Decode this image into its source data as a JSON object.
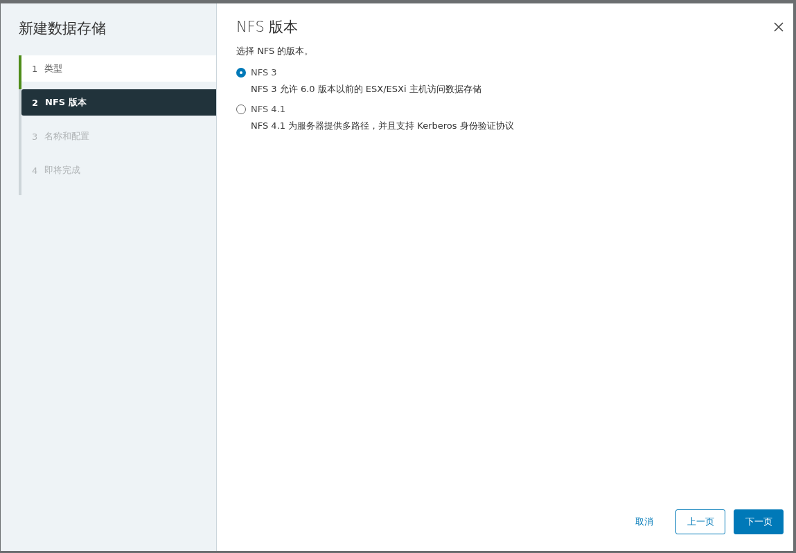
{
  "dialog": {
    "title": "新建数据存储",
    "steps": [
      {
        "number": "1",
        "label": "类型",
        "completed": true,
        "disabled": false,
        "selected": false
      },
      {
        "number": "2",
        "label": "NFS 版本",
        "completed": false,
        "disabled": false,
        "selected": true
      },
      {
        "number": "3",
        "label": "名称和配置",
        "completed": false,
        "disabled": true,
        "selected": false
      },
      {
        "number": "4",
        "label": "即将完成",
        "completed": false,
        "disabled": true,
        "selected": false
      }
    ],
    "page_title": "NFS 版本",
    "instruction": "选择 NFS 的版本。",
    "options": [
      {
        "label": "NFS 3",
        "description": "NFS 3 允许 6.0 版本以前的 ESX/ESXi 主机访问数据存储",
        "selected": true
      },
      {
        "label": "NFS 4.1",
        "description": "NFS 4.1 为服务器提供多路径，并且支持 Kerberos 身份验证协议",
        "selected": false
      }
    ],
    "buttons": [
      {
        "label": "取消",
        "kind": "link"
      },
      {
        "label": "上一页",
        "kind": "outline"
      },
      {
        "label": "下一页",
        "kind": "primary"
      }
    ]
  }
}
